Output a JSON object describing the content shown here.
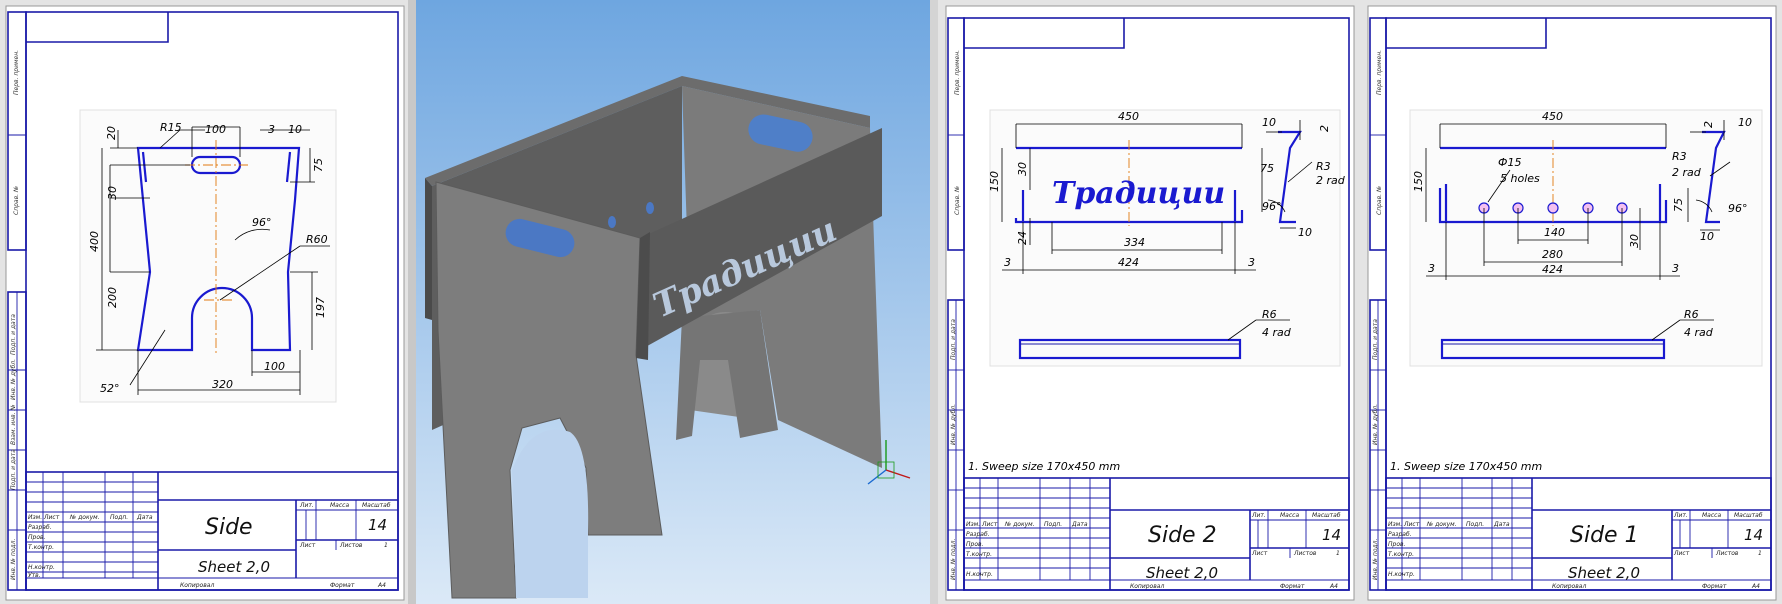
{
  "sheets": {
    "side": {
      "title": "Side",
      "sheet": "Sheet 2,0",
      "sheet_no": "14",
      "dims": {
        "r15": "R15",
        "d100_top": "100",
        "d3": "3",
        "d10": "10",
        "d20": "20",
        "d75": "75",
        "d30": "30",
        "d400": "400",
        "d200": "200",
        "d96": "96°",
        "r60": "R60",
        "d197": "197",
        "d100_bot": "100",
        "d320": "320",
        "d52": "52°"
      }
    },
    "side2": {
      "title": "Side 2",
      "sheet": "Sheet 2,0",
      "sheet_no": "14",
      "note": "1. Sweep size 170x450 mm",
      "logo": "Традиции",
      "dims": {
        "d450": "450",
        "d10": "10",
        "d2": "2",
        "d150": "150",
        "d30": "30",
        "d75": "75",
        "r3": "R3",
        "rad2": "2 rad",
        "d96": "96°",
        "d10b": "10",
        "d334": "334",
        "d24": "24",
        "d424": "424",
        "d3l": "3",
        "d3r": "3",
        "r6": "R6",
        "rad4": "4 rad"
      }
    },
    "side1": {
      "title": "Side 1",
      "sheet": "Sheet 2,0",
      "sheet_no": "14",
      "note": "1. Sweep size 170x450 mm",
      "dims": {
        "d450": "450",
        "d10": "10",
        "d2": "2",
        "d150": "150",
        "phi15": "Ф15",
        "holes": "5 holes",
        "r3": "R3",
        "rad2": "2 rad",
        "d75": "75",
        "d96": "96°",
        "d10b": "10",
        "d140": "140",
        "d280": "280",
        "d30": "30",
        "d424": "424",
        "d3l": "3",
        "d3r": "3",
        "r6": "R6",
        "rad4": "4 rad"
      }
    }
  },
  "model": {
    "logo": "Традиции"
  },
  "colors": {
    "frame": "#1a1aa8",
    "part": "#1a1ad0",
    "center": "#e07a10",
    "sky_top": "#6ea6e0",
    "sky_bottom": "#d9e8f6",
    "metal_light": "#7a7a7a",
    "metal_dark": "#585858"
  }
}
